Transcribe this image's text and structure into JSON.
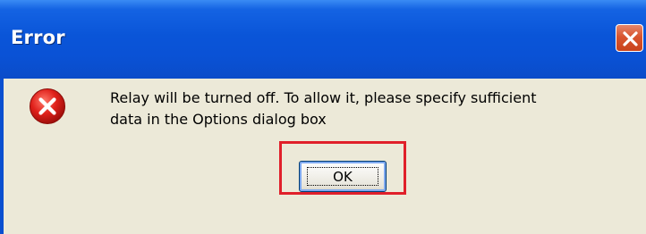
{
  "window": {
    "title": "Error",
    "title_bar_color": "#0a55d8",
    "close_icon": "close-icon"
  },
  "dialog": {
    "icon": "error-icon",
    "message_line1": "Relay will be turned off.  To allow it, please specify sufficient",
    "message_line2": "data in the Options dialog box"
  },
  "buttons": {
    "ok_label": "OK"
  },
  "annotation": {
    "highlight_color": "#e0202a"
  }
}
